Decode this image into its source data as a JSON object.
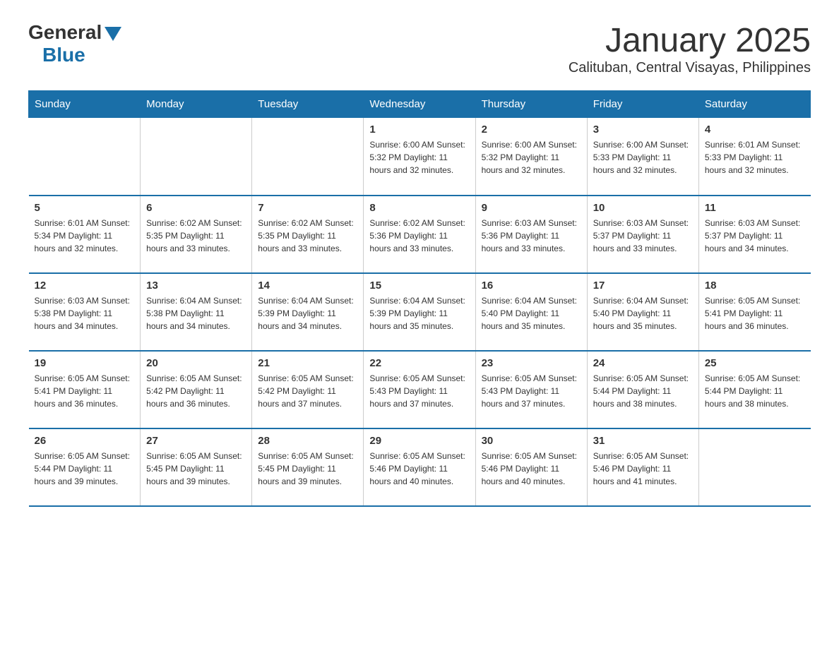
{
  "header": {
    "logo_general": "General",
    "logo_blue": "Blue",
    "title": "January 2025",
    "subtitle": "Calituban, Central Visayas, Philippines"
  },
  "days_of_week": [
    "Sunday",
    "Monday",
    "Tuesday",
    "Wednesday",
    "Thursday",
    "Friday",
    "Saturday"
  ],
  "weeks": [
    [
      {
        "day": "",
        "info": ""
      },
      {
        "day": "",
        "info": ""
      },
      {
        "day": "",
        "info": ""
      },
      {
        "day": "1",
        "info": "Sunrise: 6:00 AM\nSunset: 5:32 PM\nDaylight: 11 hours and 32 minutes."
      },
      {
        "day": "2",
        "info": "Sunrise: 6:00 AM\nSunset: 5:32 PM\nDaylight: 11 hours and 32 minutes."
      },
      {
        "day": "3",
        "info": "Sunrise: 6:00 AM\nSunset: 5:33 PM\nDaylight: 11 hours and 32 minutes."
      },
      {
        "day": "4",
        "info": "Sunrise: 6:01 AM\nSunset: 5:33 PM\nDaylight: 11 hours and 32 minutes."
      }
    ],
    [
      {
        "day": "5",
        "info": "Sunrise: 6:01 AM\nSunset: 5:34 PM\nDaylight: 11 hours and 32 minutes."
      },
      {
        "day": "6",
        "info": "Sunrise: 6:02 AM\nSunset: 5:35 PM\nDaylight: 11 hours and 33 minutes."
      },
      {
        "day": "7",
        "info": "Sunrise: 6:02 AM\nSunset: 5:35 PM\nDaylight: 11 hours and 33 minutes."
      },
      {
        "day": "8",
        "info": "Sunrise: 6:02 AM\nSunset: 5:36 PM\nDaylight: 11 hours and 33 minutes."
      },
      {
        "day": "9",
        "info": "Sunrise: 6:03 AM\nSunset: 5:36 PM\nDaylight: 11 hours and 33 minutes."
      },
      {
        "day": "10",
        "info": "Sunrise: 6:03 AM\nSunset: 5:37 PM\nDaylight: 11 hours and 33 minutes."
      },
      {
        "day": "11",
        "info": "Sunrise: 6:03 AM\nSunset: 5:37 PM\nDaylight: 11 hours and 34 minutes."
      }
    ],
    [
      {
        "day": "12",
        "info": "Sunrise: 6:03 AM\nSunset: 5:38 PM\nDaylight: 11 hours and 34 minutes."
      },
      {
        "day": "13",
        "info": "Sunrise: 6:04 AM\nSunset: 5:38 PM\nDaylight: 11 hours and 34 minutes."
      },
      {
        "day": "14",
        "info": "Sunrise: 6:04 AM\nSunset: 5:39 PM\nDaylight: 11 hours and 34 minutes."
      },
      {
        "day": "15",
        "info": "Sunrise: 6:04 AM\nSunset: 5:39 PM\nDaylight: 11 hours and 35 minutes."
      },
      {
        "day": "16",
        "info": "Sunrise: 6:04 AM\nSunset: 5:40 PM\nDaylight: 11 hours and 35 minutes."
      },
      {
        "day": "17",
        "info": "Sunrise: 6:04 AM\nSunset: 5:40 PM\nDaylight: 11 hours and 35 minutes."
      },
      {
        "day": "18",
        "info": "Sunrise: 6:05 AM\nSunset: 5:41 PM\nDaylight: 11 hours and 36 minutes."
      }
    ],
    [
      {
        "day": "19",
        "info": "Sunrise: 6:05 AM\nSunset: 5:41 PM\nDaylight: 11 hours and 36 minutes."
      },
      {
        "day": "20",
        "info": "Sunrise: 6:05 AM\nSunset: 5:42 PM\nDaylight: 11 hours and 36 minutes."
      },
      {
        "day": "21",
        "info": "Sunrise: 6:05 AM\nSunset: 5:42 PM\nDaylight: 11 hours and 37 minutes."
      },
      {
        "day": "22",
        "info": "Sunrise: 6:05 AM\nSunset: 5:43 PM\nDaylight: 11 hours and 37 minutes."
      },
      {
        "day": "23",
        "info": "Sunrise: 6:05 AM\nSunset: 5:43 PM\nDaylight: 11 hours and 37 minutes."
      },
      {
        "day": "24",
        "info": "Sunrise: 6:05 AM\nSunset: 5:44 PM\nDaylight: 11 hours and 38 minutes."
      },
      {
        "day": "25",
        "info": "Sunrise: 6:05 AM\nSunset: 5:44 PM\nDaylight: 11 hours and 38 minutes."
      }
    ],
    [
      {
        "day": "26",
        "info": "Sunrise: 6:05 AM\nSunset: 5:44 PM\nDaylight: 11 hours and 39 minutes."
      },
      {
        "day": "27",
        "info": "Sunrise: 6:05 AM\nSunset: 5:45 PM\nDaylight: 11 hours and 39 minutes."
      },
      {
        "day": "28",
        "info": "Sunrise: 6:05 AM\nSunset: 5:45 PM\nDaylight: 11 hours and 39 minutes."
      },
      {
        "day": "29",
        "info": "Sunrise: 6:05 AM\nSunset: 5:46 PM\nDaylight: 11 hours and 40 minutes."
      },
      {
        "day": "30",
        "info": "Sunrise: 6:05 AM\nSunset: 5:46 PM\nDaylight: 11 hours and 40 minutes."
      },
      {
        "day": "31",
        "info": "Sunrise: 6:05 AM\nSunset: 5:46 PM\nDaylight: 11 hours and 41 minutes."
      },
      {
        "day": "",
        "info": ""
      }
    ]
  ]
}
